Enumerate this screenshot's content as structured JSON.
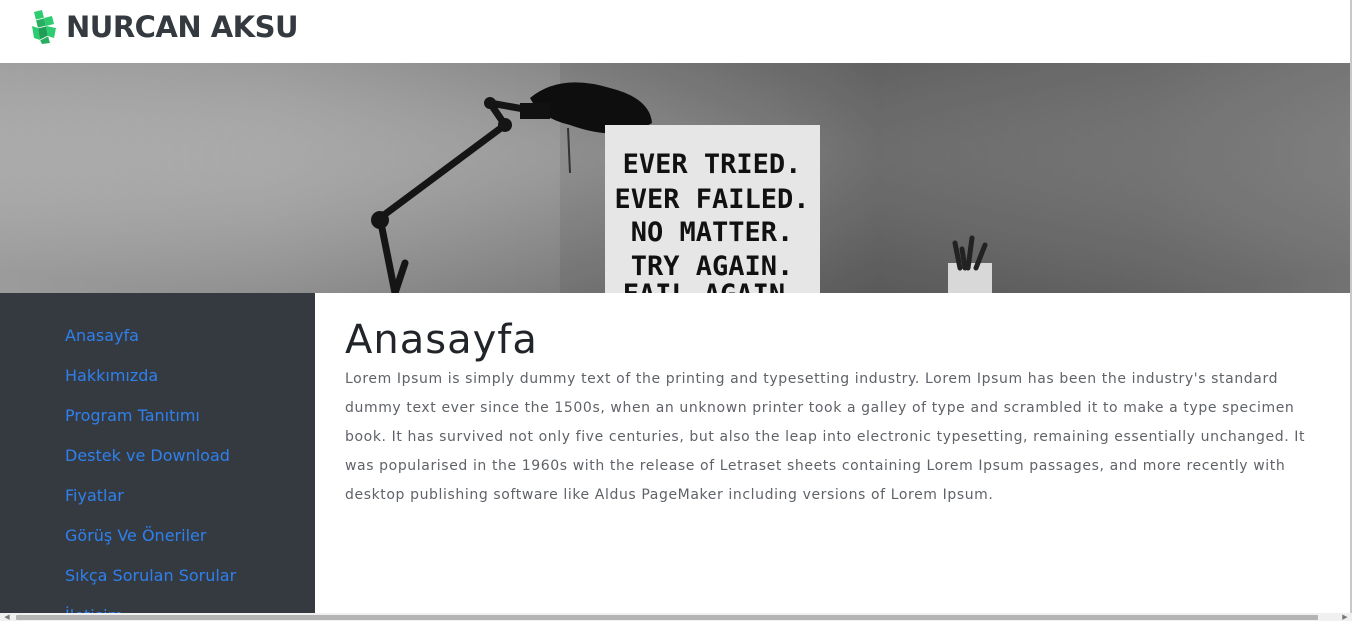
{
  "header": {
    "logo_icon": "cubes-logo-icon",
    "logo_text": "NURCAN AKSU",
    "logo_color": "#2ecc71"
  },
  "hero": {
    "image": "desk-lamp-poster-photo",
    "poster_lines": [
      "EVER TRIED.",
      "EVER FAILED.",
      "NO MATTER.",
      "TRY AGAIN.",
      "FAIL AGAIN."
    ]
  },
  "sidebar": {
    "background": "#343a40",
    "link_color": "#2f80ed",
    "items": [
      {
        "label": "Anasayfa"
      },
      {
        "label": "Hakkımızda"
      },
      {
        "label": "Program Tanıtımı"
      },
      {
        "label": "Destek ve Download"
      },
      {
        "label": "Fiyatlar"
      },
      {
        "label": "Görüş Ve Öneriler"
      },
      {
        "label": "Sıkça Sorulan Sorular"
      },
      {
        "label": "İletişim"
      }
    ]
  },
  "main": {
    "title": "Anasayfa",
    "body": "Lorem Ipsum is simply dummy text of the printing and typesetting industry. Lorem Ipsum has been the industry's standard dummy text ever since the 1500s, when an unknown printer took a galley of type and scrambled it to make a type specimen book. It has survived not only five centuries, but also the leap into electronic typesetting, remaining essentially unchanged. It was popularised in the 1960s with the release of Letraset sheets containing Lorem Ipsum passages, and more recently with desktop publishing software like Aldus PageMaker including versions of Lorem Ipsum."
  },
  "scrollbar": {
    "left_arrow": "◀",
    "right_arrow": "▶"
  }
}
